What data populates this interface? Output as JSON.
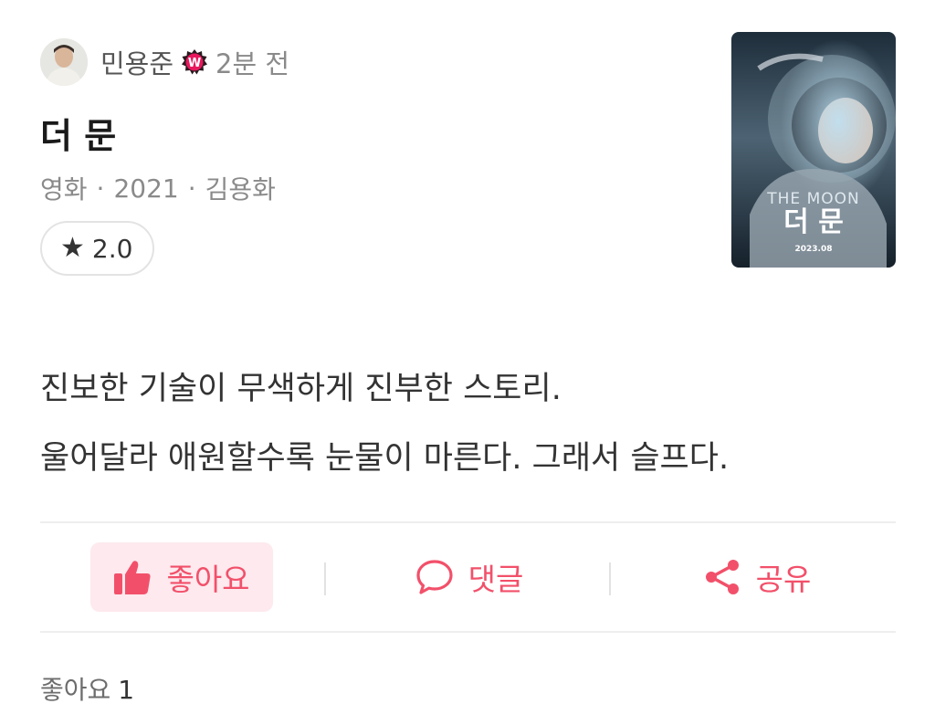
{
  "review": {
    "author": "민용준",
    "badge_letter": "W",
    "time_ago": "2분 전",
    "movie_title": "더 문",
    "meta": {
      "category": "영화",
      "year": "2021",
      "director": "김용화",
      "separator": "·"
    },
    "rating": {
      "icon": "star-icon",
      "value": "2.0"
    },
    "poster": {
      "title_en": "THE MOON",
      "title_ko": "더 문",
      "release": "2023.08"
    },
    "text_lines": [
      "진보한 기술이 무색하게 진부한 스토리.",
      "울어달라 애원할수록 눈물이 마른다. 그래서 슬프다."
    ]
  },
  "actions": {
    "like": {
      "label": "좋아요",
      "icon": "thumbs-up-icon"
    },
    "comment": {
      "label": "댓글",
      "icon": "speech-bubble-icon"
    },
    "share": {
      "label": "공유",
      "icon": "share-icon"
    }
  },
  "likes_summary": {
    "label": "좋아요",
    "count": "1"
  },
  "colors": {
    "accent": "#f2506a",
    "like_bg": "#fde9ee",
    "badge": "#e8185e"
  }
}
